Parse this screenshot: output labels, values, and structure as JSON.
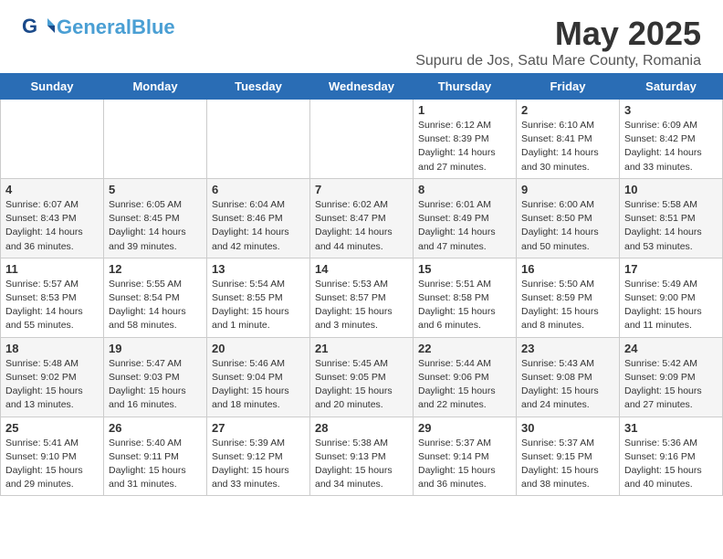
{
  "header": {
    "logo_general": "General",
    "logo_blue": "Blue",
    "title": "May 2025",
    "subtitle": "Supuru de Jos, Satu Mare County, Romania"
  },
  "weekdays": [
    "Sunday",
    "Monday",
    "Tuesday",
    "Wednesday",
    "Thursday",
    "Friday",
    "Saturday"
  ],
  "weeks": [
    [
      {
        "day": "",
        "info": ""
      },
      {
        "day": "",
        "info": ""
      },
      {
        "day": "",
        "info": ""
      },
      {
        "day": "",
        "info": ""
      },
      {
        "day": "1",
        "info": "Sunrise: 6:12 AM\nSunset: 8:39 PM\nDaylight: 14 hours\nand 27 minutes."
      },
      {
        "day": "2",
        "info": "Sunrise: 6:10 AM\nSunset: 8:41 PM\nDaylight: 14 hours\nand 30 minutes."
      },
      {
        "day": "3",
        "info": "Sunrise: 6:09 AM\nSunset: 8:42 PM\nDaylight: 14 hours\nand 33 minutes."
      }
    ],
    [
      {
        "day": "4",
        "info": "Sunrise: 6:07 AM\nSunset: 8:43 PM\nDaylight: 14 hours\nand 36 minutes."
      },
      {
        "day": "5",
        "info": "Sunrise: 6:05 AM\nSunset: 8:45 PM\nDaylight: 14 hours\nand 39 minutes."
      },
      {
        "day": "6",
        "info": "Sunrise: 6:04 AM\nSunset: 8:46 PM\nDaylight: 14 hours\nand 42 minutes."
      },
      {
        "day": "7",
        "info": "Sunrise: 6:02 AM\nSunset: 8:47 PM\nDaylight: 14 hours\nand 44 minutes."
      },
      {
        "day": "8",
        "info": "Sunrise: 6:01 AM\nSunset: 8:49 PM\nDaylight: 14 hours\nand 47 minutes."
      },
      {
        "day": "9",
        "info": "Sunrise: 6:00 AM\nSunset: 8:50 PM\nDaylight: 14 hours\nand 50 minutes."
      },
      {
        "day": "10",
        "info": "Sunrise: 5:58 AM\nSunset: 8:51 PM\nDaylight: 14 hours\nand 53 minutes."
      }
    ],
    [
      {
        "day": "11",
        "info": "Sunrise: 5:57 AM\nSunset: 8:53 PM\nDaylight: 14 hours\nand 55 minutes."
      },
      {
        "day": "12",
        "info": "Sunrise: 5:55 AM\nSunset: 8:54 PM\nDaylight: 14 hours\nand 58 minutes."
      },
      {
        "day": "13",
        "info": "Sunrise: 5:54 AM\nSunset: 8:55 PM\nDaylight: 15 hours\nand 1 minute."
      },
      {
        "day": "14",
        "info": "Sunrise: 5:53 AM\nSunset: 8:57 PM\nDaylight: 15 hours\nand 3 minutes."
      },
      {
        "day": "15",
        "info": "Sunrise: 5:51 AM\nSunset: 8:58 PM\nDaylight: 15 hours\nand 6 minutes."
      },
      {
        "day": "16",
        "info": "Sunrise: 5:50 AM\nSunset: 8:59 PM\nDaylight: 15 hours\nand 8 minutes."
      },
      {
        "day": "17",
        "info": "Sunrise: 5:49 AM\nSunset: 9:00 PM\nDaylight: 15 hours\nand 11 minutes."
      }
    ],
    [
      {
        "day": "18",
        "info": "Sunrise: 5:48 AM\nSunset: 9:02 PM\nDaylight: 15 hours\nand 13 minutes."
      },
      {
        "day": "19",
        "info": "Sunrise: 5:47 AM\nSunset: 9:03 PM\nDaylight: 15 hours\nand 16 minutes."
      },
      {
        "day": "20",
        "info": "Sunrise: 5:46 AM\nSunset: 9:04 PM\nDaylight: 15 hours\nand 18 minutes."
      },
      {
        "day": "21",
        "info": "Sunrise: 5:45 AM\nSunset: 9:05 PM\nDaylight: 15 hours\nand 20 minutes."
      },
      {
        "day": "22",
        "info": "Sunrise: 5:44 AM\nSunset: 9:06 PM\nDaylight: 15 hours\nand 22 minutes."
      },
      {
        "day": "23",
        "info": "Sunrise: 5:43 AM\nSunset: 9:08 PM\nDaylight: 15 hours\nand 24 minutes."
      },
      {
        "day": "24",
        "info": "Sunrise: 5:42 AM\nSunset: 9:09 PM\nDaylight: 15 hours\nand 27 minutes."
      }
    ],
    [
      {
        "day": "25",
        "info": "Sunrise: 5:41 AM\nSunset: 9:10 PM\nDaylight: 15 hours\nand 29 minutes."
      },
      {
        "day": "26",
        "info": "Sunrise: 5:40 AM\nSunset: 9:11 PM\nDaylight: 15 hours\nand 31 minutes."
      },
      {
        "day": "27",
        "info": "Sunrise: 5:39 AM\nSunset: 9:12 PM\nDaylight: 15 hours\nand 33 minutes."
      },
      {
        "day": "28",
        "info": "Sunrise: 5:38 AM\nSunset: 9:13 PM\nDaylight: 15 hours\nand 34 minutes."
      },
      {
        "day": "29",
        "info": "Sunrise: 5:37 AM\nSunset: 9:14 PM\nDaylight: 15 hours\nand 36 minutes."
      },
      {
        "day": "30",
        "info": "Sunrise: 5:37 AM\nSunset: 9:15 PM\nDaylight: 15 hours\nand 38 minutes."
      },
      {
        "day": "31",
        "info": "Sunrise: 5:36 AM\nSunset: 9:16 PM\nDaylight: 15 hours\nand 40 minutes."
      }
    ]
  ]
}
